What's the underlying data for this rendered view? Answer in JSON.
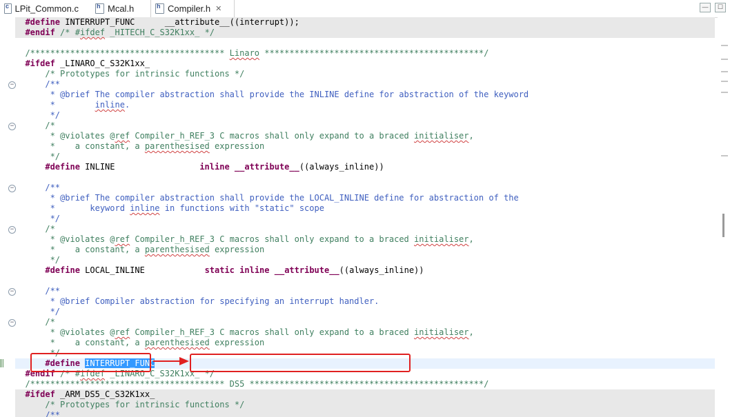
{
  "tabs": [
    {
      "label": "LPit_Common.c",
      "icon": "c-source-file-icon",
      "active": false
    },
    {
      "label": "Mcal.h",
      "icon": "header-file-icon",
      "active": false
    },
    {
      "label": "Compiler.h",
      "icon": "header-file-icon",
      "active": true,
      "close": "✕"
    }
  ],
  "window_buttons": {
    "minimize": "—",
    "maximize": "☐"
  },
  "colors": {
    "keyword": "#7f0055",
    "comment": "#3f7f5f",
    "doc": "#3f5fbf",
    "annotation_red": "#e02020",
    "selection": "#3399ff"
  },
  "code": [
    {
      "t": "<k>#define</k> INTERRUPT_FUNC      __attribute__((interrupt));",
      "bg": "shade"
    },
    {
      "t": "<k>#endif</k> <c>/* #</c><c><q>ifdef</q></c><c> _HITECH_C_S32K1xx_ */</c>",
      "bg": "shade"
    },
    {
      "t": ""
    },
    {
      "t": "<c>/*************************************** </c><c><q>Linaro</q></c><c> ********************************************/</c>"
    },
    {
      "t": "<k>#ifdef</k> _LINARO_C_S32K1xx_"
    },
    {
      "t": "    <c>/* Prototypes for intrinsic functions */</c>"
    },
    {
      "t": "    <g>/**</g>"
    },
    {
      "t": "    <g> * @brief The compiler abstraction shall provide the INLINE define for abstraction of the keyword</g>"
    },
    {
      "t": "    <g> *        </g><g><q>inline</q></g><g>.</g>"
    },
    {
      "t": "    <g> */</g>"
    },
    {
      "t": "    <c>/*</c>"
    },
    {
      "t": "    <c> * @violates @</c><c><q>ref</q></c><c> Compiler_h_REF_3 C macros shall only expand to a braced </c><c><q>initialiser</q></c><c>,</c>"
    },
    {
      "t": "    <c> *    a constant, a </c><c><q>parenthesised</q></c><c> expression</c>"
    },
    {
      "t": "    <c> */</c>"
    },
    {
      "t": "    <k>#define</k> INLINE                 <k>inline</k> <k>__attribute__</k>((always_inline))"
    },
    {
      "t": ""
    },
    {
      "t": "    <g>/**</g>"
    },
    {
      "t": "    <g> * @brief The compiler abstraction shall provide the LOCAL_INLINE define for abstraction of the</g>"
    },
    {
      "t": "    <g> *       keyword </g><g><q>inline</q></g><g> in functions with \"static\" scope</g>"
    },
    {
      "t": "    <g> */</g>"
    },
    {
      "t": "    <c>/*</c>"
    },
    {
      "t": "    <c> * @violates @</c><c><q>ref</q></c><c> Compiler_h_REF_3 C macros shall only expand to a braced </c><c><q>initialiser</q></c><c>,</c>"
    },
    {
      "t": "    <c> *    a constant, a </c><c><q>parenthesised</q></c><c> expression</c>"
    },
    {
      "t": "    <c> */</c>"
    },
    {
      "t": "    <k>#define</k> LOCAL_INLINE            <k>static</k> <k>inline</k> <k>__attribute__</k>((always_inline))"
    },
    {
      "t": ""
    },
    {
      "t": "    <g>/**</g>"
    },
    {
      "t": "    <g> * @brief Compiler abstraction for specifying an interrupt handler.</g>"
    },
    {
      "t": "    <g> */</g>"
    },
    {
      "t": "    <c>/*</c>"
    },
    {
      "t": "    <c> * @violates @</c><c><q>ref</q></c><c> Compiler_h_REF_3 C macros shall only expand to a braced </c><c><q>initialiser</q></c><c>,</c>"
    },
    {
      "t": "    <c> *    a constant, a </c><c><q>parenthesised</q></c><c> expression</c>"
    },
    {
      "t": "    <c> */</c>"
    },
    {
      "t": "    <k>#define</k> <s>INTERRUPT_FUNC</s>",
      "bg": "curline"
    },
    {
      "t": "<k>#endif</k> <c>/* #</c><c><q>ifdef</q></c><c> _LINARO_C_S32K1xx_ */</c>"
    },
    {
      "t": "<c>/*************************************** DS5 ***********************************************/</c>"
    },
    {
      "t": "<k>#ifdef</k> _ARM_DS5_C_S32K1xx_",
      "bg": "shade"
    },
    {
      "t": "    <c>/* Prototypes for intrinsic functions */</c>",
      "bg": "shade"
    },
    {
      "t": "    <g>/**</g>",
      "bg": "shade"
    }
  ]
}
